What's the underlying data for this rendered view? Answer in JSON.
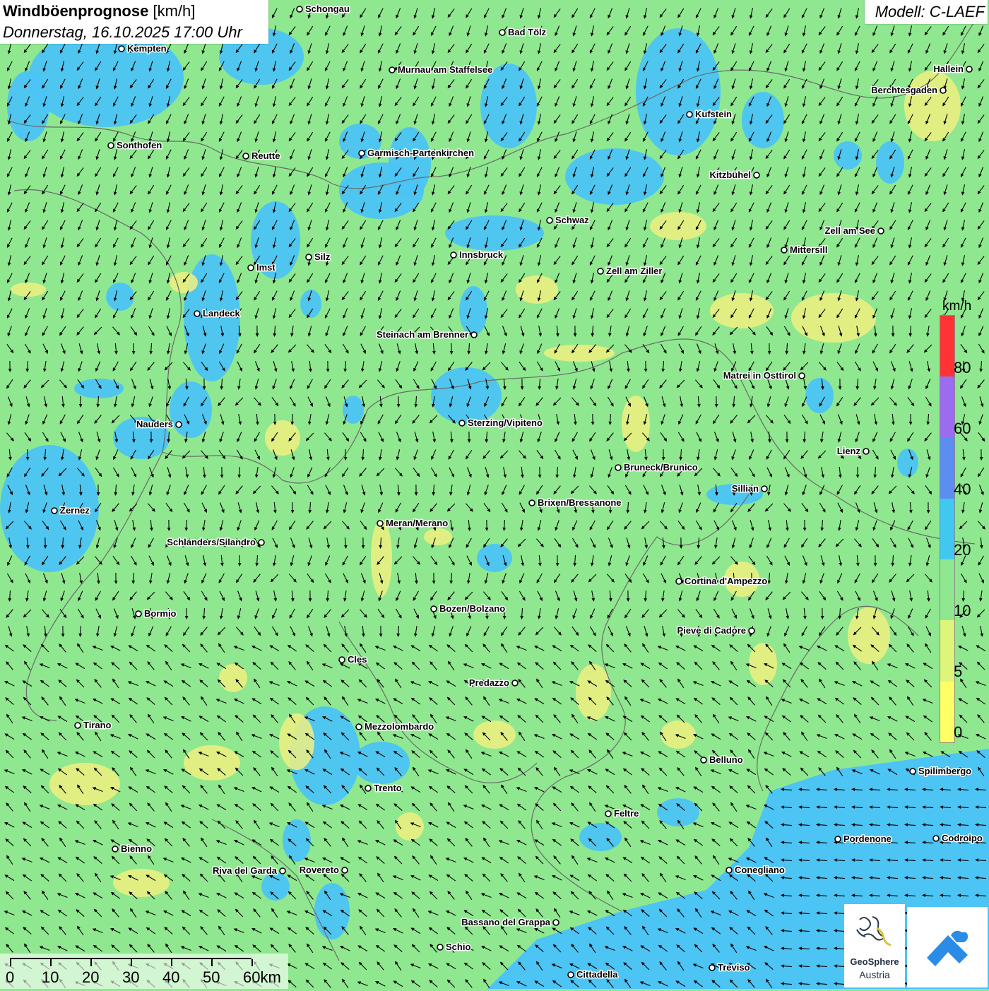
{
  "header": {
    "title_bold": "Windböenprognose",
    "title_unit": "[km/h]",
    "subtitle": "Donnerstag, 16.10.2025 17:00 Uhr",
    "model": "Modell: C-LAEF"
  },
  "legend": {
    "unit": "km/h",
    "colors": [
      "#ffff66",
      "#ddf57a",
      "#8fe88f",
      "#40c8f0",
      "#5b8ef0",
      "#9b6cf0",
      "#ff3333"
    ],
    "ticks": [
      "0",
      "5",
      "10",
      "20",
      "40",
      "60",
      "80"
    ]
  },
  "scale_bar": {
    "labels": [
      "0",
      "10",
      "20",
      "30",
      "40",
      "50",
      "60km"
    ]
  },
  "logo": {
    "name": "GeoSphere",
    "country": "Austria",
    "app_icon": "weather-app-icon"
  },
  "colors": {
    "land_green": "#8fe88f",
    "wind_blue": "#4cc4f4",
    "calm_yellow": "#f0f080",
    "sea_blue": "#4cc4f4",
    "border": "#6a6a6a"
  },
  "cities": [
    {
      "name": "Schongau"
    },
    {
      "name": "Bad Tölz"
    },
    {
      "name": "Kempten"
    },
    {
      "name": "Hallein"
    },
    {
      "name": "Murnau am Staffelsee"
    },
    {
      "name": "Berchtesgaden"
    },
    {
      "name": "Kufstein"
    },
    {
      "name": "Sonthofen"
    },
    {
      "name": "Reutte"
    },
    {
      "name": "Garmisch-Partenkirchen"
    },
    {
      "name": "Kitzbühel"
    },
    {
      "name": "Schwaz"
    },
    {
      "name": "Zell am See"
    },
    {
      "name": "Innsbruck"
    },
    {
      "name": "Mittersill"
    },
    {
      "name": "Silz"
    },
    {
      "name": "Imst"
    },
    {
      "name": "Zell am Ziller"
    },
    {
      "name": "Landeck"
    },
    {
      "name": "Steinach am Brenner"
    },
    {
      "name": "Matrei in Osttirol"
    },
    {
      "name": "Nauders"
    },
    {
      "name": "Sterzing/Vipiteno"
    },
    {
      "name": "Lienz"
    },
    {
      "name": "Bruneck/Brunico"
    },
    {
      "name": "Sillian"
    },
    {
      "name": "Brixen/Bressanone"
    },
    {
      "name": "Zernez"
    },
    {
      "name": "Meran/Merano"
    },
    {
      "name": "Schlanders/Silandro"
    },
    {
      "name": "Cortina d'Ampezzo"
    },
    {
      "name": "Bozen/Bolzano"
    },
    {
      "name": "Bormio"
    },
    {
      "name": "Pieve di Cadore"
    },
    {
      "name": "Cles"
    },
    {
      "name": "Predazzo"
    },
    {
      "name": "Tirano"
    },
    {
      "name": "Mezzolombardo"
    },
    {
      "name": "Belluno"
    },
    {
      "name": "Spilimbergo"
    },
    {
      "name": "Trento"
    },
    {
      "name": "Feltre"
    },
    {
      "name": "Pordenone"
    },
    {
      "name": "Codroipo"
    },
    {
      "name": "Bienno"
    },
    {
      "name": "Riva del Garda"
    },
    {
      "name": "Rovereto"
    },
    {
      "name": "Conegliano"
    },
    {
      "name": "Bassano del Grappa"
    },
    {
      "name": "Schio"
    },
    {
      "name": "Treviso"
    },
    {
      "name": "Cittadella"
    }
  ]
}
